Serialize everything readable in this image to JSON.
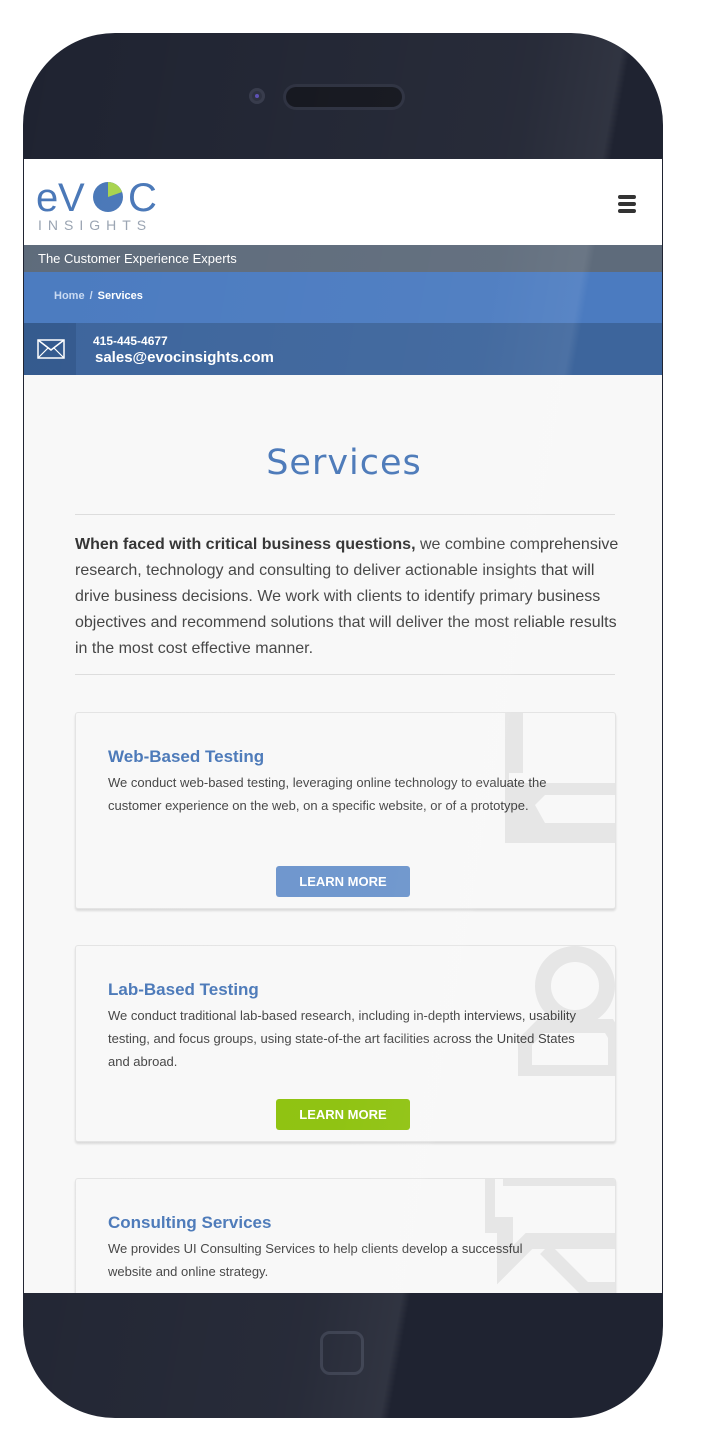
{
  "header": {
    "logo_text": "eVOC",
    "logo_subtext": "INSIGHTS"
  },
  "tagline": "The Customer Experience Experts",
  "breadcrumb": {
    "home": "Home",
    "separator": "/",
    "current": "Services"
  },
  "contact": {
    "phone": "415-445-4677",
    "email": "sales@evocinsights.com"
  },
  "page": {
    "title": "Services",
    "intro_bold": "When faced with critical business questions,",
    "intro_rest": " we combine comprehensive research, technology and consulting to deliver actionable insights that will drive business decisions. We work with clients to identify primary business objectives and recommend solutions that will deliver the most reliable results in the most cost effective manner."
  },
  "cards": [
    {
      "title": "Web-Based Testing",
      "text": "We conduct web-based testing, leveraging online technology to evaluate the customer experience on the web, on a specific website, or of a prototype.",
      "button": "LEARN MORE"
    },
    {
      "title": "Lab-Based Testing",
      "text": "We conduct traditional lab-based research, including in-depth interviews, usability testing, and focus groups, using state-of-the art facilities across the United States and abroad.",
      "button": "LEARN MORE"
    },
    {
      "title": "Consulting Services",
      "text": "We provides UI Consulting Services to help clients develop a successful website and online strategy."
    }
  ],
  "colors": {
    "brand_blue": "#4a78b8",
    "button_blue": "#6b94cc",
    "button_green": "#8cc10a",
    "logo_green": "#a8d44f"
  },
  "icons": {
    "menu": "hamburger-menu-icon",
    "contact": "envelope-icon",
    "card1_watermark": "monitor-icon",
    "card2_watermark": "person-icon",
    "card3_watermark": "chat-bubble-icon"
  }
}
